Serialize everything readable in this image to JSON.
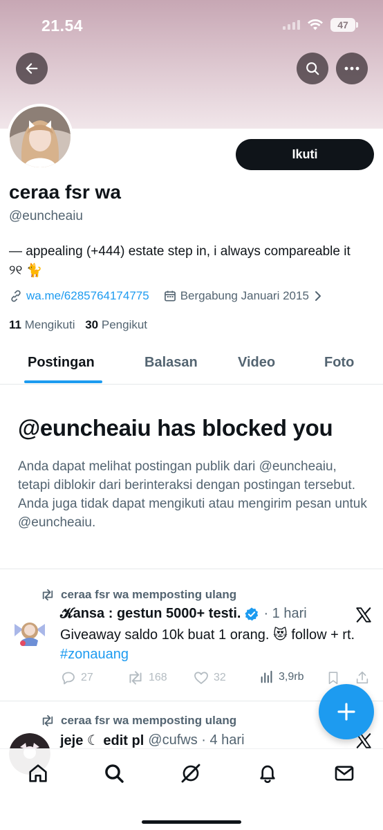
{
  "status_bar": {
    "time": "21.54",
    "battery": "47"
  },
  "header": {
    "back_icon": "arrow-left-icon",
    "search_icon": "search-icon",
    "more_icon": "more-dots-icon"
  },
  "profile": {
    "display_name": "ceraa fsr wa",
    "handle": "@euncheaiu",
    "follow_label": "Ikuti",
    "bio": "— appealing (+444) estate step in, i always compareable it ୨୧ 🐈",
    "link": "wa.me/6285764174775",
    "joined": "Bergabung Januari 2015",
    "following_count": "11",
    "following_label": "Mengikuti",
    "followers_count": "30",
    "followers_label": "Pengikut"
  },
  "tabs": [
    {
      "label": "Postingan",
      "active": true
    },
    {
      "label": "Balasan",
      "active": false
    },
    {
      "label": "Video",
      "active": false
    },
    {
      "label": "Foto",
      "active": false
    }
  ],
  "blocked": {
    "title": "@euncheaiu has blocked you",
    "description": "Anda dapat melihat postingan publik dari @euncheaiu, tetapi diblokir dari berinteraksi dengan postingan tersebut. Anda juga tidak dapat mengikuti atau mengirim pesan untuk @euncheaiu."
  },
  "posts": [
    {
      "repost_label": "ceraa fsr wa memposting ulang",
      "author": "𝓚ansa : gestun 5000+ testi.",
      "verified": true,
      "meta": "· 1 hari",
      "text": "Giveaway saldo 10k buat 1 orang. 😻 follow + rt.",
      "hashtag": "#zonauang",
      "replies": "27",
      "reposts": "168",
      "likes": "32",
      "views": "3,9rb"
    },
    {
      "repost_label": "ceraa fsr wa memposting ulang",
      "author": "jeje ☾ edit pl",
      "meta": "@cufws · 4 hari"
    }
  ],
  "bottom_nav": [
    "home-icon",
    "search-icon",
    "grok-icon",
    "notifications-bell-icon",
    "messages-envelope-icon"
  ],
  "colors": {
    "accent": "#1d9bf0",
    "text_primary": "#0f1419",
    "text_secondary": "#536471",
    "banner": "#d9c2cb"
  }
}
